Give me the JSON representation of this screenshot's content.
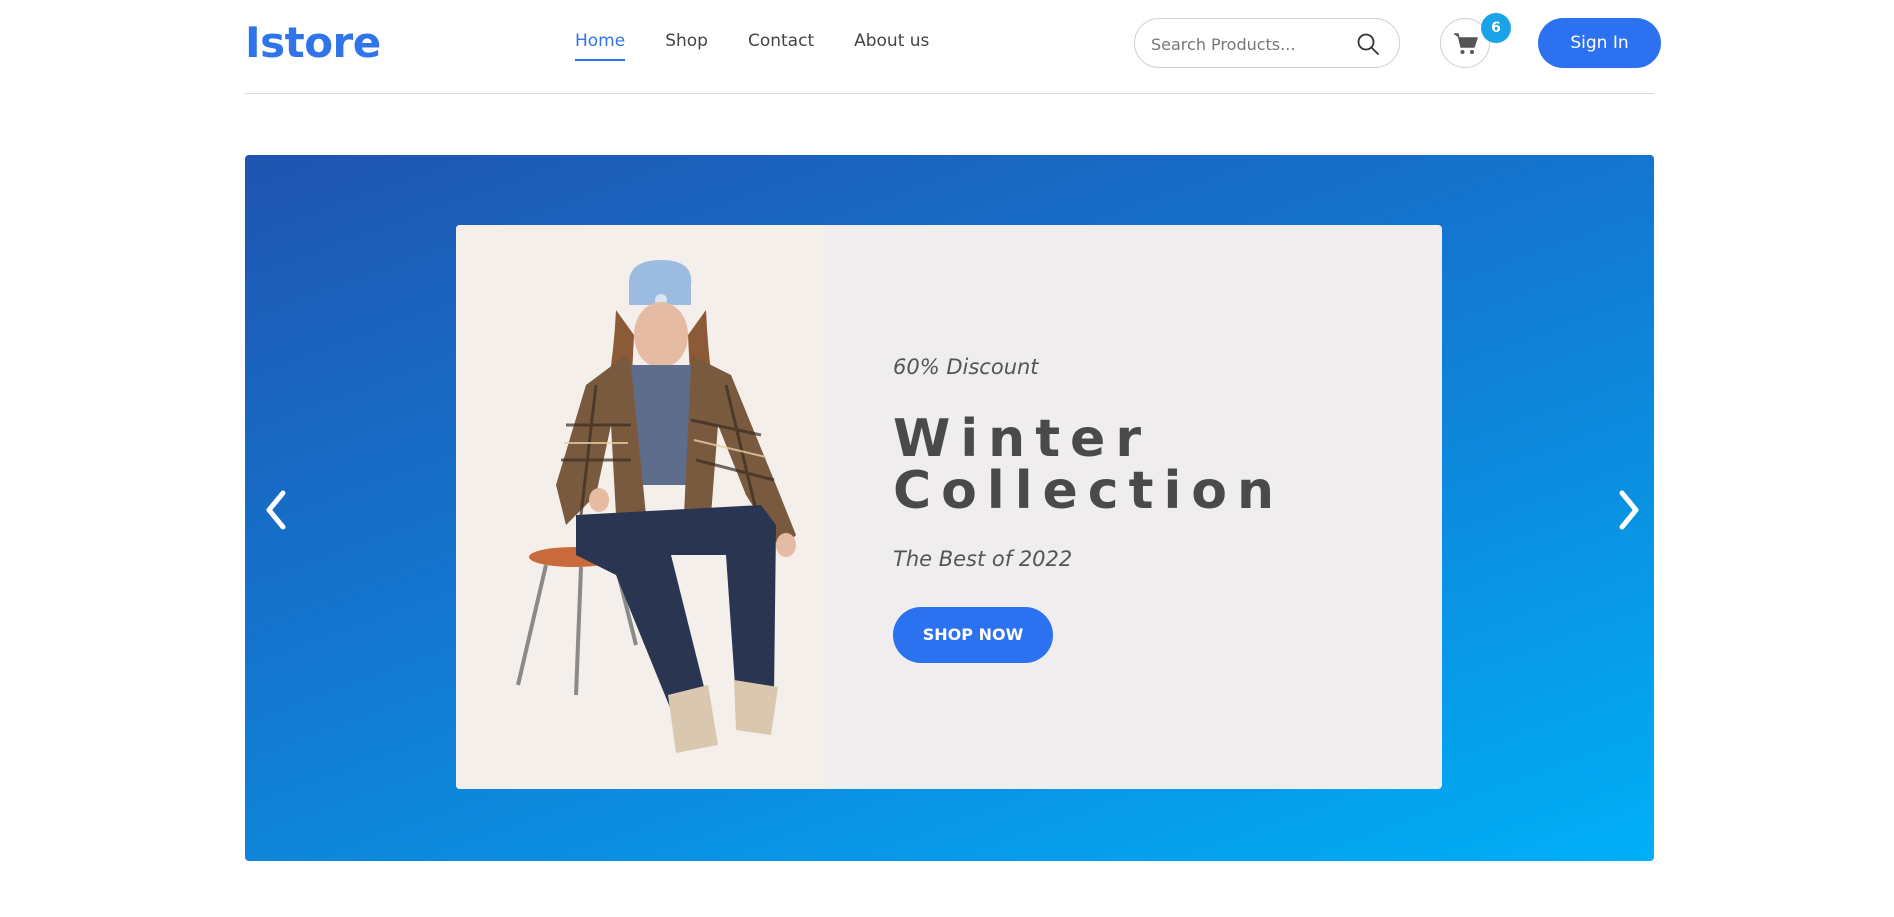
{
  "brand": {
    "logo": "Istore",
    "accent": "#2f74e8"
  },
  "nav": {
    "items": [
      {
        "label": "Home",
        "active": true
      },
      {
        "label": "Shop",
        "active": false
      },
      {
        "label": "Contact",
        "active": false
      },
      {
        "label": "About us",
        "active": false
      }
    ]
  },
  "search": {
    "placeholder": "Search Products...",
    "icon": "search-icon"
  },
  "cart": {
    "icon": "cart-icon",
    "count": "6"
  },
  "signin": {
    "label": "Sign In"
  },
  "hero": {
    "discount": "60% Discount",
    "headline_line1": "Winter",
    "headline_line2": "Collection",
    "subline": "The Best of 2022",
    "cta": "SHOP NOW",
    "image": "model-photo",
    "prev_icon": "chevron-left-icon",
    "next_icon": "chevron-right-icon"
  }
}
